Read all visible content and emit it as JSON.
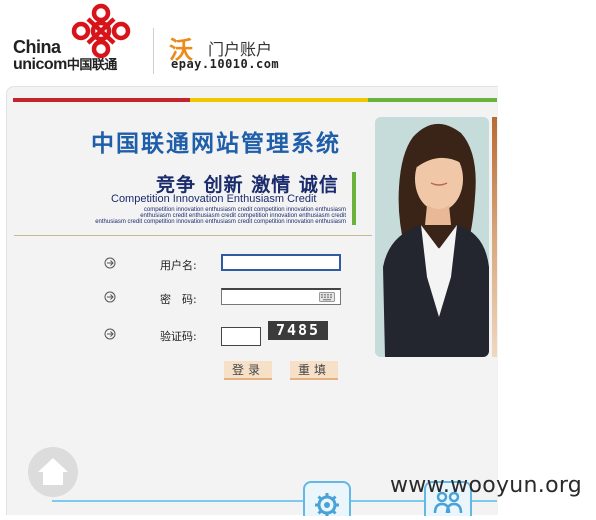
{
  "header": {
    "brand_en_line1": "China",
    "brand_en_line2": "unicom",
    "brand_cn": "中国联通",
    "wo_char": "沃",
    "wo_title": "门户账户",
    "wo_site": "epay.10010.com"
  },
  "banner": {
    "system_title": "中国联通网站管理系统",
    "slogan_cn": "竞争 创新 激情 诚信",
    "slogan_en": "Competition  Innovation  Enthusiasm  Credit",
    "small_lines": [
      "competition innovation enthusiasm credit competition innovation enthusiasm",
      "enthusiasm credit enthusiasm credit competition innovation enthusiasm credit",
      "enthusiasm credit competition innovation enthusiasm credit competition innovation enthusiasm"
    ]
  },
  "form": {
    "username_label": "用户名:",
    "password_label": "密　码:",
    "captcha_label": "验证码:",
    "username_value": "",
    "password_value": "",
    "captcha_value": "",
    "captcha_code": "7485",
    "login_label": "登录",
    "reset_label": "重填"
  },
  "watermark": "www.wooyun.org",
  "colors": {
    "stripe_red": "#c4232b",
    "stripe_yellow": "#f0c800",
    "stripe_green": "#6cb33e",
    "title_blue": "#1f5ea8",
    "wo_orange": "#ec8b1c"
  }
}
